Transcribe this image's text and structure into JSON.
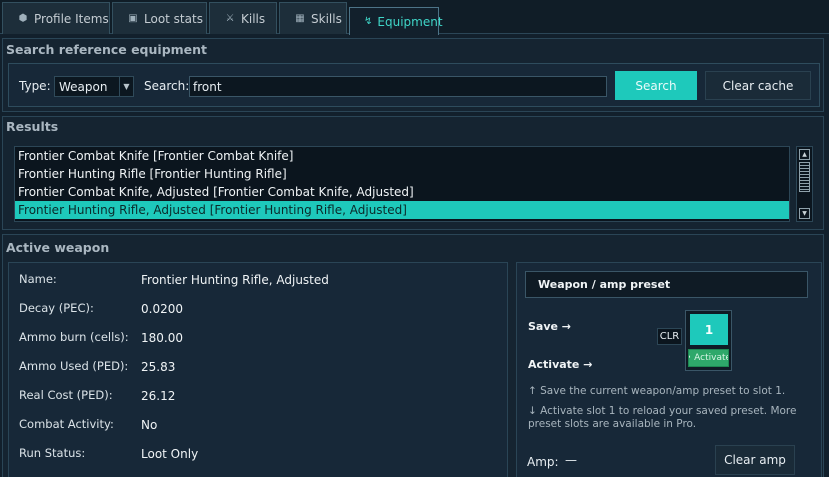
{
  "tabs": [
    {
      "label": "Profile Items",
      "icon": "cube-icon"
    },
    {
      "label": "Loot stats",
      "icon": "chest-icon"
    },
    {
      "label": "Kills",
      "icon": "crossed-swords-icon"
    },
    {
      "label": "Skills",
      "icon": "grid-icon"
    },
    {
      "label": "Equipment",
      "icon": "wrench-icon",
      "active": true
    }
  ],
  "search_section": {
    "title": "Search reference equipment",
    "type_label": "Type:",
    "type_value": "Weapon",
    "search_label": "Search:",
    "search_value": "front",
    "search_button": "Search",
    "clear_cache_button": "Clear cache"
  },
  "results": {
    "title": "Results",
    "items": [
      "Frontier Combat Knife  [Frontier Combat Knife]",
      "Frontier Hunting Rifle  [Frontier Hunting Rifle]",
      "Frontier Combat Knife, Adjusted  [Frontier Combat Knife, Adjusted]",
      "Frontier Hunting Rifle, Adjusted  [Frontier Hunting Rifle, Adjusted]"
    ],
    "selected_index": 3
  },
  "active_weapon": {
    "title": "Active weapon",
    "fields": [
      {
        "label": "Name:",
        "value": "Frontier Hunting Rifle, Adjusted"
      },
      {
        "label": "Decay (PEC):",
        "value": "0.0200"
      },
      {
        "label": "Ammo burn (cells):",
        "value": "180.00"
      },
      {
        "label": "Ammo Used (PED):",
        "value": "25.83"
      },
      {
        "label": "Real Cost (PED):",
        "value": "26.12"
      },
      {
        "label": "Combat Activity:",
        "value": "No"
      },
      {
        "label": "Run Status:",
        "value": "Loot Only"
      }
    ]
  },
  "preset": {
    "title": "Weapon / amp preset",
    "save_label": "Save →",
    "activate_label": "Activate →",
    "clr_label": "CLR",
    "slot_label": "1",
    "slot_activate_label": "• Activate",
    "note_save": "↑ Save the current weapon/amp preset to slot 1.",
    "note_activate": "↓ Activate slot 1 to reload your saved preset. More preset slots are available in Pro.",
    "amp_label": "Amp:",
    "amp_value": "—",
    "clear_amp_button": "Clear amp"
  },
  "colors": {
    "accent": "#1ec9bb",
    "background": "#12202c",
    "activate_green": "#2ea86a"
  }
}
